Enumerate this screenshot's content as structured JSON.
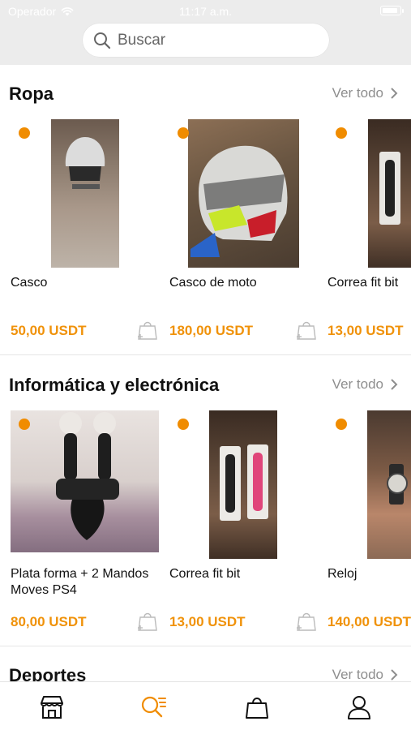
{
  "status_bar": {
    "carrier": "Operador",
    "time": "11:17 a.m."
  },
  "search": {
    "placeholder": "Buscar"
  },
  "see_all_label": "Ver todo",
  "sections": [
    {
      "title": "Ropa",
      "items": [
        {
          "title": "Casco",
          "price": "50,00 USDT"
        },
        {
          "title": "Casco de moto",
          "price": "180,00 USDT"
        },
        {
          "title": "Correa fit bit",
          "price": "13,00 USDT"
        }
      ]
    },
    {
      "title": "Informática y electrónica",
      "items": [
        {
          "title": "Plata forma + 2 Mandos Moves PS4",
          "price": "80,00 USDT"
        },
        {
          "title": "Correa fit bit",
          "price": "13,00 USDT"
        },
        {
          "title": "Reloj",
          "price": "140,00 USDT"
        }
      ]
    },
    {
      "title": "Deportes",
      "items": []
    }
  ],
  "tab_bar": {
    "items": [
      {
        "icon": "store-icon"
      },
      {
        "icon": "search-list-icon",
        "active": true
      },
      {
        "icon": "bag-icon"
      },
      {
        "icon": "profile-icon"
      }
    ]
  },
  "colors": {
    "accent": "#f08c00",
    "price": "#f0920a",
    "header_bg": "#ececec",
    "muted": "#8e8e8e"
  }
}
